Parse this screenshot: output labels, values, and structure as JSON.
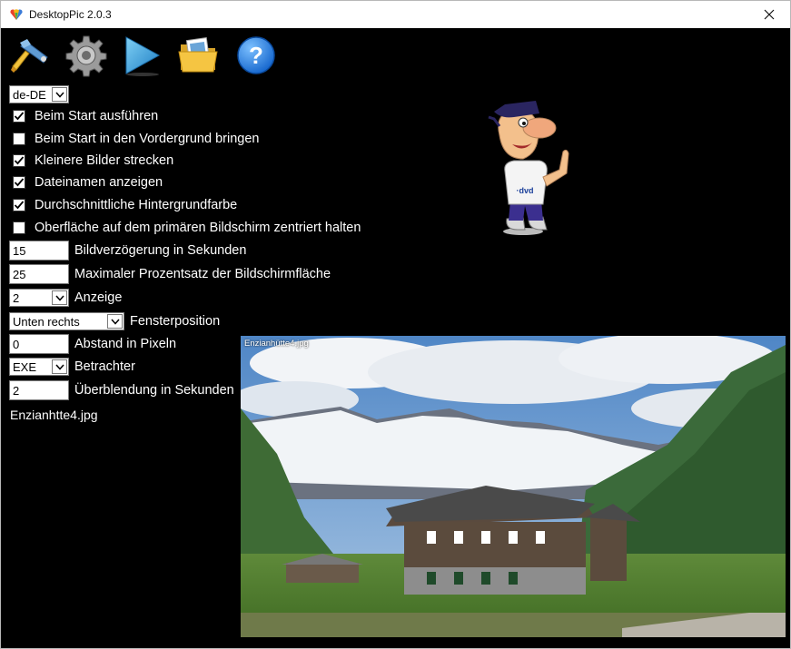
{
  "window": {
    "title": "DesktopPic 2.0.3"
  },
  "toolbar": [
    {
      "name": "tools-icon",
      "tooltip": ""
    },
    {
      "name": "gear-icon",
      "tooltip": ""
    },
    {
      "name": "play-icon",
      "tooltip": ""
    },
    {
      "name": "folder-icon",
      "tooltip": ""
    },
    {
      "name": "help-icon",
      "tooltip": ""
    }
  ],
  "language": {
    "selected": "de-DE"
  },
  "checkboxes": [
    {
      "label": "Beim Start ausführen",
      "checked": true
    },
    {
      "label": "Beim Start in den Vordergrund bringen",
      "checked": false
    },
    {
      "label": "Kleinere Bilder strecken",
      "checked": true
    },
    {
      "label": "Dateinamen anzeigen",
      "checked": true
    },
    {
      "label": "Durchschnittliche Hintergrundfarbe",
      "checked": true
    },
    {
      "label": "Oberfläche auf dem primären Bildschirm zentriert halten",
      "checked": false
    }
  ],
  "settings": {
    "delay": {
      "value": "15",
      "label": "Bildverzögerung in Sekunden"
    },
    "max_area": {
      "value": "25",
      "label": "Maximaler Prozentsatz der Bildschirmfläche"
    },
    "display": {
      "value": "2",
      "label": "Anzeige"
    },
    "position": {
      "value": "Unten rechts",
      "label": "Fensterposition"
    },
    "spacing": {
      "value": "0",
      "label": "Abstand in Pixeln"
    },
    "viewer": {
      "value": "EXE",
      "label": "Betrachter"
    },
    "crossfade": {
      "value": "2",
      "label": "Überblendung in Sekunden"
    }
  },
  "current_file": "Enzianhtte4.jpg",
  "preview": {
    "caption": "Enzianhütte4.jpg"
  },
  "mascot": {
    "shirt_text": "·dvd"
  }
}
